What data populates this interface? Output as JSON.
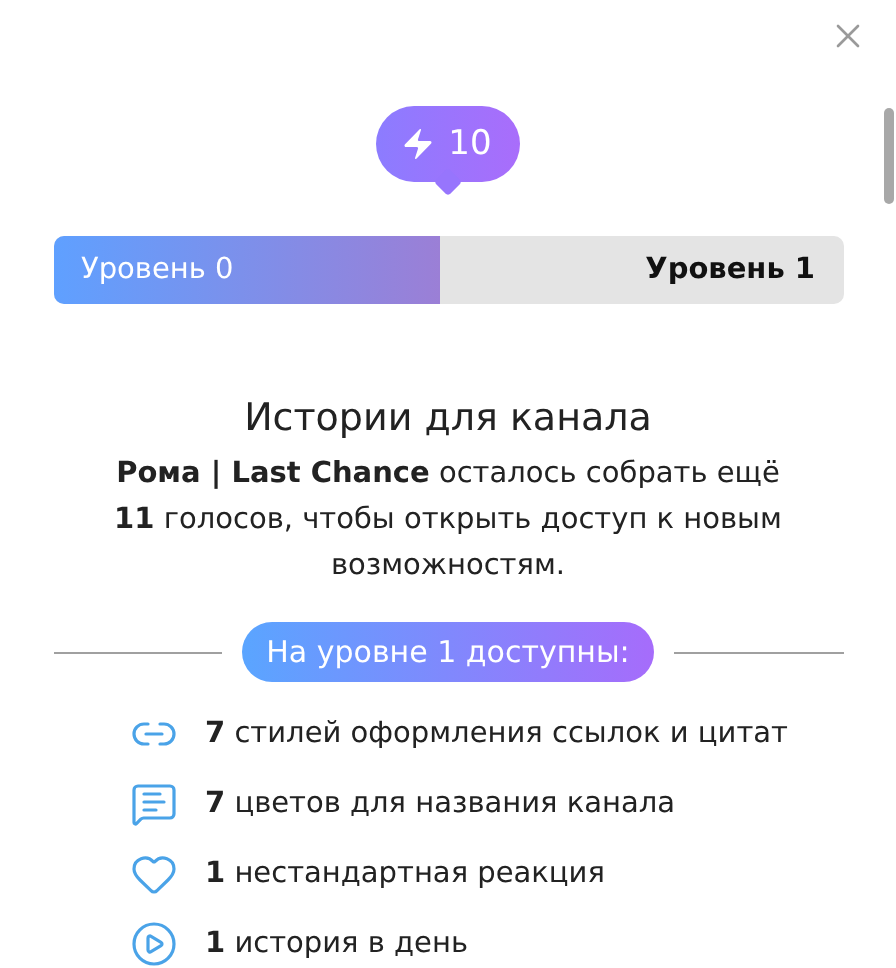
{
  "badge": {
    "count": "10"
  },
  "progress": {
    "from_label": "Уровень 0",
    "to_label": "Уровень 1",
    "level": 0.49
  },
  "title": "Истории для канала",
  "description": "**Рома | Last Chance** осталось собрать ещё **11** голосов, чтобы открыть доступ к новым возможностям.",
  "section_label": "На уровне 1 доступны:",
  "features": [
    {
      "kind": "link",
      "text": "**7** стилей оформления ссылок и цитат"
    },
    {
      "kind": "colors",
      "text": "**7** цветов для названия канала"
    },
    {
      "kind": "reaction",
      "text": "**1** нестандартная реакция"
    },
    {
      "kind": "story",
      "text": "**1** история в день"
    }
  ]
}
